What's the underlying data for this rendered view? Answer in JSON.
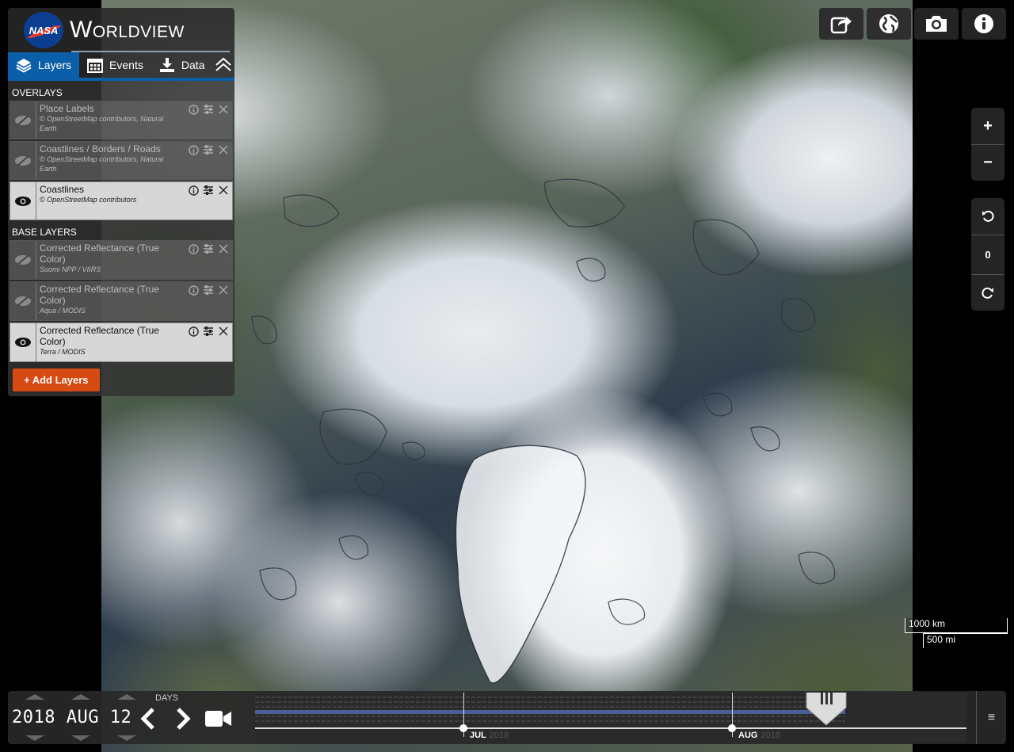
{
  "app": {
    "agency": "NASA",
    "title": "Worldview"
  },
  "tabs": [
    {
      "label": "Layers",
      "icon": "layers-icon",
      "active": true
    },
    {
      "label": "Events",
      "icon": "calendar-icon",
      "active": false
    },
    {
      "label": "Data",
      "icon": "download-icon",
      "active": false
    }
  ],
  "overlays": {
    "title": "OVERLAYS",
    "items": [
      {
        "name": "Place Labels",
        "source": "© OpenStreetMap contributors, Natural Earth",
        "visible": false
      },
      {
        "name": "Coastlines / Borders / Roads",
        "source": "© OpenStreetMap contributors, Natural Earth",
        "visible": false
      },
      {
        "name": "Coastlines",
        "source": "© OpenStreetMap contributors",
        "visible": true
      }
    ]
  },
  "base_layers": {
    "title": "BASE LAYERS",
    "items": [
      {
        "name": "Corrected Reflectance (True Color)",
        "source": "Suomi NPP / VIIRS",
        "visible": false
      },
      {
        "name": "Corrected Reflectance (True Color)",
        "source": "Aqua / MODIS",
        "visible": false
      },
      {
        "name": "Corrected Reflectance (True Color)",
        "source": "Terra / MODIS",
        "visible": true
      }
    ]
  },
  "add_layers_label": "+ Add Layers",
  "toolbar": [
    "share-icon",
    "projection-globe-icon",
    "camera-icon",
    "info-icon"
  ],
  "zoom": {
    "in": "+",
    "out": "−"
  },
  "rotation": {
    "value": "0"
  },
  "scale": {
    "km": "1000 km",
    "mi": "500 mi"
  },
  "timeline": {
    "date": "2018 AUG 12",
    "interval_label": "DAYS",
    "months": [
      {
        "label": "JUL",
        "year": "2018"
      },
      {
        "label": "AUG",
        "year": "2018"
      }
    ]
  },
  "colors": {
    "accent": "#0b5ea8",
    "add_button": "#d84a14",
    "panel_bg": "#323232"
  }
}
